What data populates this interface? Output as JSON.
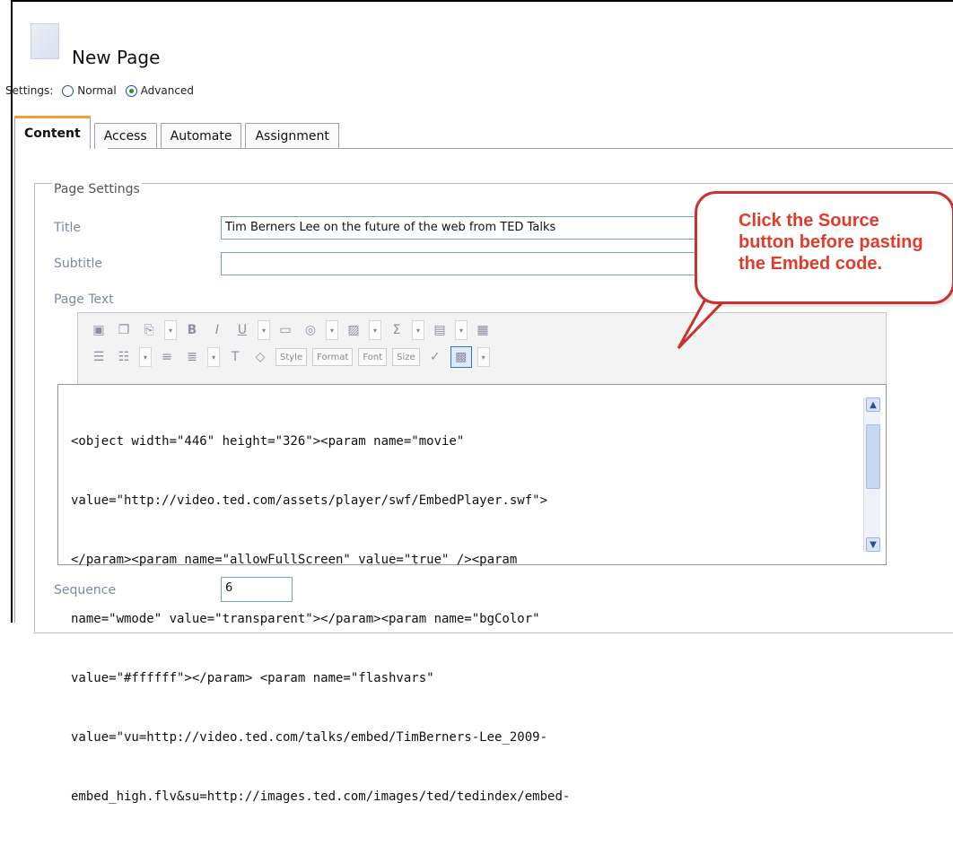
{
  "page": {
    "title": "New Page"
  },
  "settings": {
    "label": "Settings:",
    "options": [
      "Normal",
      "Advanced"
    ],
    "selected": "Advanced"
  },
  "tabs": [
    {
      "label": "Content",
      "active": true
    },
    {
      "label": "Access"
    },
    {
      "label": "Automate"
    },
    {
      "label": "Assignment"
    }
  ],
  "page_settings": {
    "legend": "Page Settings",
    "title_label": "Title",
    "title_value": "Tim Berners Lee on the future of the web from TED Talks",
    "subtitle_label": "Subtitle",
    "subtitle_value": "",
    "page_text_label": "Page Text",
    "sequence_label": "Sequence",
    "sequence_value": "6"
  },
  "toolbar": {
    "style": "Style",
    "format": "Format",
    "font": "Font",
    "size": "Size"
  },
  "editor": {
    "lines": [
      "<object width=\"446\" height=\"326\"><param name=\"movie\"",
      "value=\"http://video.ted.com/assets/player/swf/EmbedPlayer.swf\">",
      "</param><param name=\"allowFullScreen\" value=\"true\" /><param",
      "name=\"wmode\" value=\"transparent\"></param><param name=\"bgColor\"",
      "value=\"#ffffff\"></param> <param name=\"flashvars\"",
      "value=\"vu=http://video.ted.com/talks/embed/TimBerners-Lee_2009-",
      "embed_high.flv&su=http://images.ted.com/images/ted/tedindex/embed-"
    ]
  },
  "callout": {
    "text": "Click the Source button before pasting the Embed code."
  },
  "colors": {
    "tab_accent": "#f0a030",
    "callout": "#c9322e"
  }
}
